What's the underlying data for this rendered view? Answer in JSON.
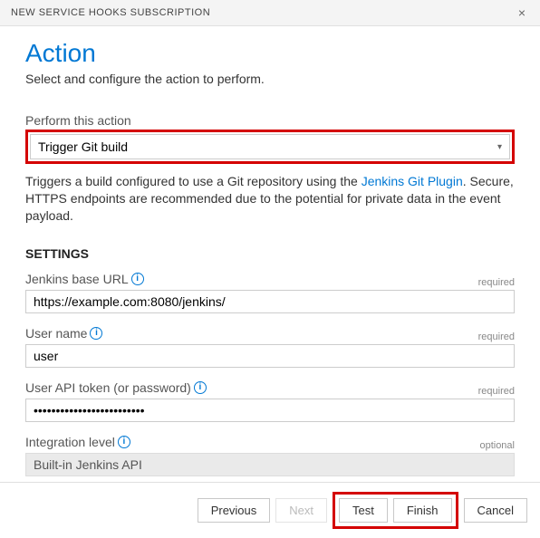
{
  "header": {
    "title": "NEW SERVICE HOOKS SUBSCRIPTION",
    "close": "×"
  },
  "page": {
    "title": "Action",
    "subtitle": "Select and configure the action to perform."
  },
  "action": {
    "label": "Perform this action",
    "value": "Trigger Git build",
    "description_pre": "Triggers a build configured to use a Git repository using the ",
    "description_link": "Jenkins Git Plugin",
    "description_post": ". Secure, HTTPS endpoints are recommended due to the potential for private data in the event payload."
  },
  "settings": {
    "heading": "SETTINGS",
    "base_url": {
      "label": "Jenkins base URL",
      "hint": "required",
      "value": "https://example.com:8080/jenkins/"
    },
    "user_name": {
      "label": "User name",
      "hint": "required",
      "value": "user"
    },
    "api_token": {
      "label": "User API token (or password)",
      "hint": "required",
      "value": "•••••••••••••••••••••••••"
    },
    "integration": {
      "label": "Integration level",
      "hint": "optional",
      "value": "Built-in Jenkins API"
    }
  },
  "footer": {
    "previous": "Previous",
    "next": "Next",
    "test": "Test",
    "finish": "Finish",
    "cancel": "Cancel"
  },
  "icons": {
    "info": "i"
  }
}
